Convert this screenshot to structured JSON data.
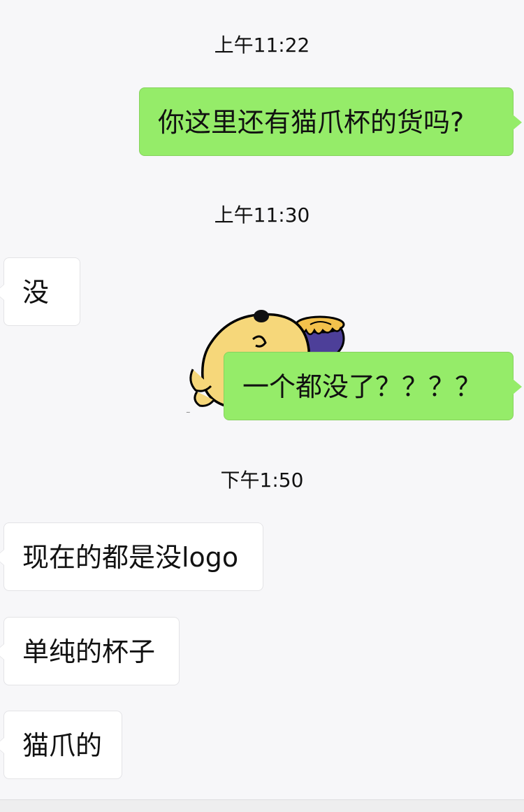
{
  "chat": {
    "timestamps": [
      "上午11:22",
      "上午11:30",
      "下午1:50"
    ],
    "messages": [
      {
        "direction": "outgoing",
        "text": "你这里还有猫爪杯的货吗?"
      },
      {
        "direction": "incoming",
        "text": "没"
      },
      {
        "direction": "outgoing",
        "text": "一个都没了？？？？"
      },
      {
        "direction": "incoming",
        "text": "现在的都是没logo"
      },
      {
        "direction": "incoming",
        "text": "单纯的杯子"
      },
      {
        "direction": "incoming",
        "text": "猫爪的"
      }
    ],
    "sticker": {
      "name": "sleeping-bear-with-honey-pot"
    },
    "colors": {
      "background": "#f7f7f9",
      "outgoing_bubble": "#95ec69",
      "incoming_bubble": "#ffffff"
    }
  }
}
